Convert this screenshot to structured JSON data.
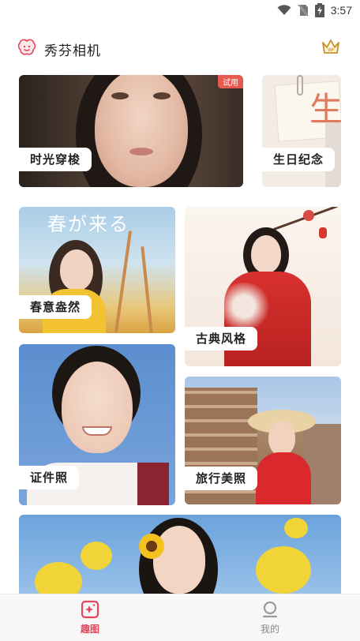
{
  "status_bar": {
    "time": "3:57"
  },
  "header": {
    "title": "秀芬相机"
  },
  "cards": {
    "time_travel": {
      "label": "时光穿梭",
      "badge": "试用"
    },
    "birthday": {
      "label": "生日纪念",
      "decor_text": "生"
    },
    "spring": {
      "label": "春意盎然",
      "decor_text": "春が来る"
    },
    "classical": {
      "label": "古典风格"
    },
    "id_photo": {
      "label": "证件照"
    },
    "travel": {
      "label": "旅行美照"
    }
  },
  "bottom_nav": {
    "items": [
      {
        "label": "趣图",
        "icon": "sparkle-image-icon",
        "active": true
      },
      {
        "label": "我的",
        "icon": "person-icon",
        "active": false
      }
    ]
  },
  "colors": {
    "accent": "#e8445a",
    "badge": "#e8594f",
    "crown": "#c8902a"
  }
}
